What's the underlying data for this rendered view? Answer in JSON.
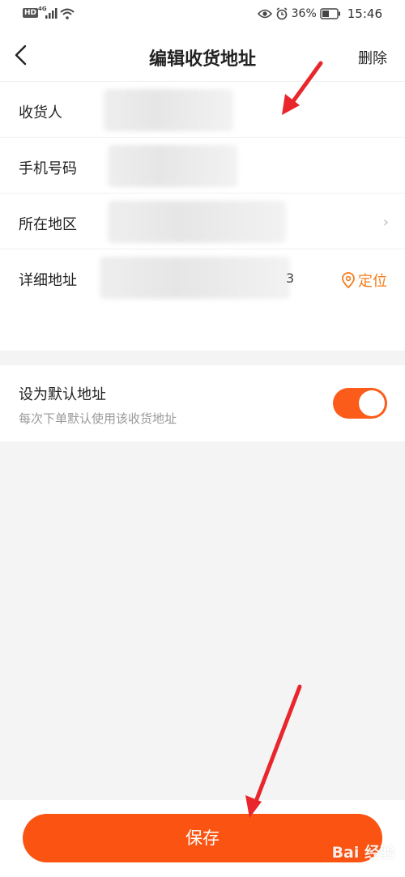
{
  "status_bar": {
    "hd": "HD",
    "network": "4G",
    "battery": "36%",
    "time": "15:46"
  },
  "header": {
    "title": "编辑收货地址",
    "delete_label": "删除"
  },
  "form": {
    "rows": [
      {
        "label": "收货人"
      },
      {
        "label": "手机号码"
      },
      {
        "label": "所在地区",
        "chevron": "›"
      },
      {
        "label": "详细地址",
        "tail_char": "3",
        "locate_label": "定位"
      }
    ]
  },
  "default_address": {
    "title": "设为默认地址",
    "subtitle": "每次下单默认使用该收货地址",
    "enabled": true
  },
  "footer": {
    "save_label": "保存"
  },
  "watermark": "Bai 经验",
  "colors": {
    "accent": "#fb5412",
    "locate": "#f57c1a",
    "arrow": "#e8262b"
  },
  "icons": {
    "back": "chevron-left-icon",
    "locate": "location-pin-icon",
    "region": "chevron-right-icon"
  }
}
